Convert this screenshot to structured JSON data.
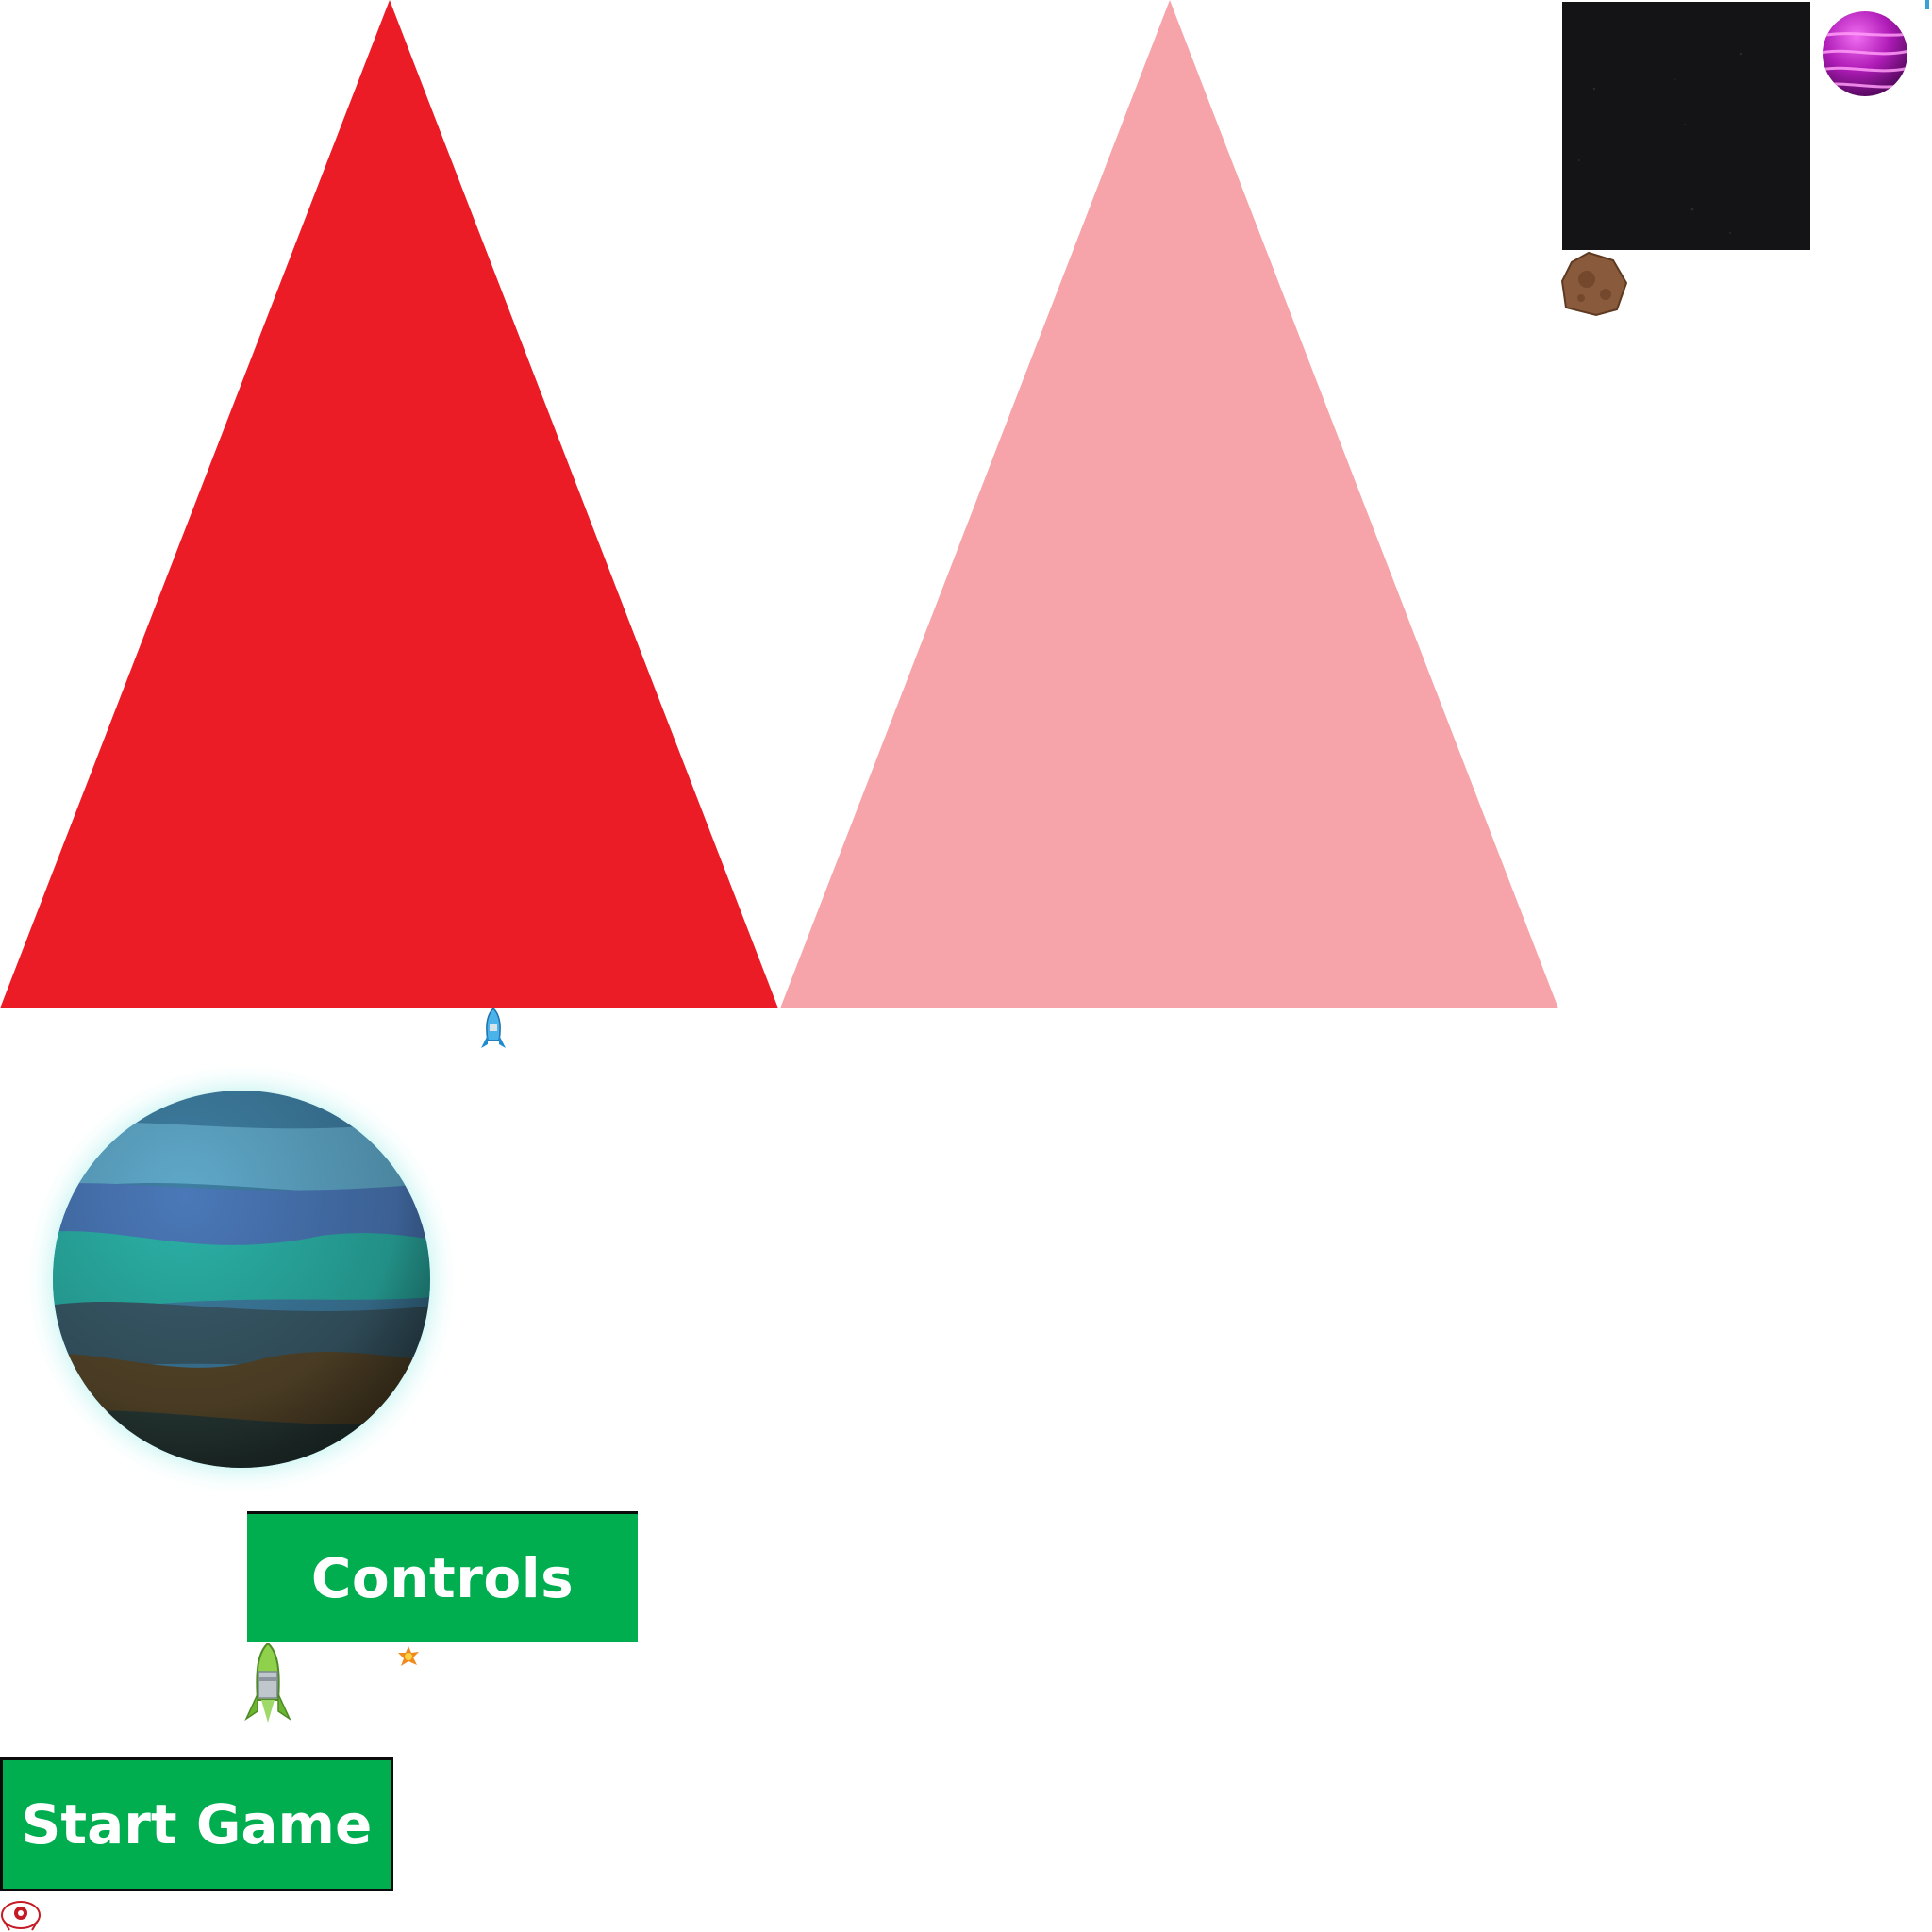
{
  "menu": {
    "controls_label": "Controls",
    "start_label": "Start Game"
  },
  "colors": {
    "button_green": "#00ad4f",
    "button_border": "#0b0b0b",
    "triangle_red": "#ec1c27",
    "triangle_pink": "#f6a4a9",
    "space_dark": "#141316"
  },
  "sprites": [
    {
      "name": "triangle-red",
      "icon": "red-triangle-sprite"
    },
    {
      "name": "triangle-pink",
      "icon": "pink-triangle-sprite"
    },
    {
      "name": "space-tile",
      "icon": "starfield-tile"
    },
    {
      "name": "purple-planet",
      "icon": "purple-ringed-planet"
    },
    {
      "name": "asteroid",
      "icon": "brown-asteroid"
    },
    {
      "name": "blue-rocket",
      "icon": "small-blue-rocket"
    },
    {
      "name": "earth-planet",
      "icon": "blue-green-planet"
    },
    {
      "name": "green-rocket",
      "icon": "green-rocket-ship"
    },
    {
      "name": "explosion",
      "icon": "orange-explosion"
    },
    {
      "name": "ufo-ship",
      "icon": "red-white-ufo"
    }
  ]
}
